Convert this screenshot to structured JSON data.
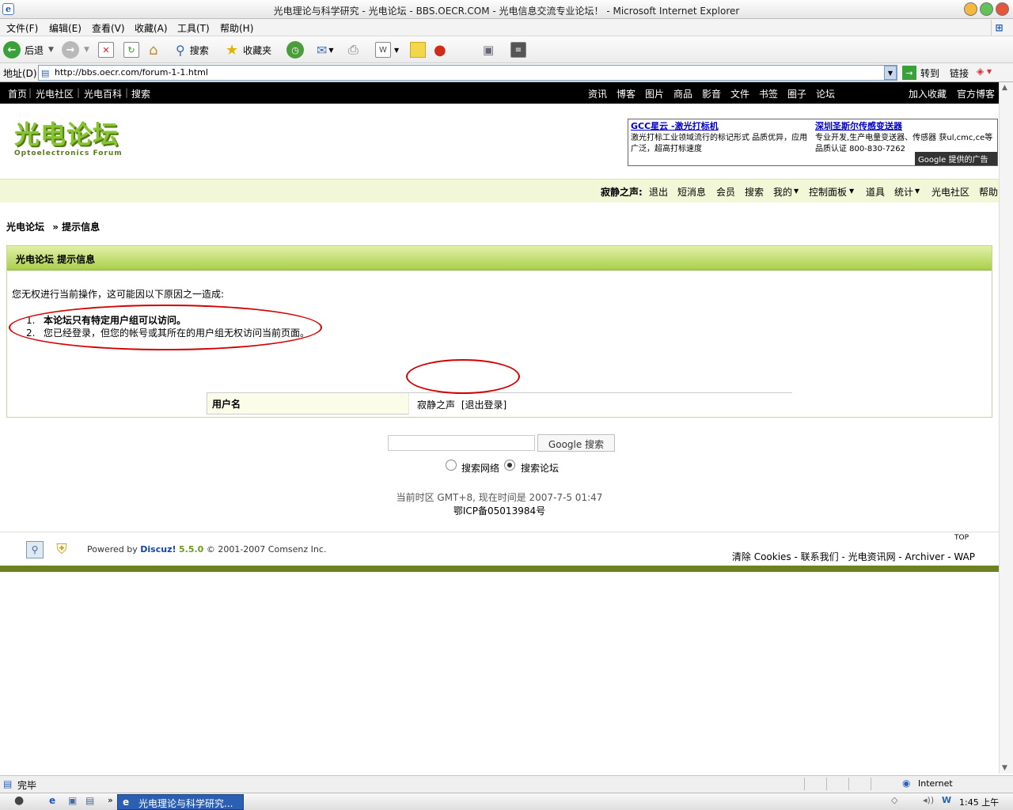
{
  "window": {
    "title": "光电理论与科学研究 - 光电论坛 - BBS.OECR.COM - 光电信息交流专业论坛！ - Microsoft Internet Explorer"
  },
  "menu": [
    "文件(F)",
    "编辑(E)",
    "查看(V)",
    "收藏(A)",
    "工具(T)",
    "帮助(H)"
  ],
  "toolbar": {
    "back": "后退",
    "search": "搜索",
    "favorites": "收藏夹"
  },
  "address": {
    "label": "地址(D)",
    "url": "http://bbs.oecr.com/forum-1-1.html",
    "go": "转到",
    "links": "链接"
  },
  "topnav": {
    "left": [
      "首页",
      "光电社区",
      "光电百科",
      "搜索"
    ],
    "right": [
      "资讯",
      "博客",
      "图片",
      "商品",
      "影音",
      "文件",
      "书签",
      "圈子",
      "论坛"
    ],
    "far": [
      "加入收藏",
      "官方博客"
    ]
  },
  "logo": {
    "title": "光电论坛",
    "subtitle": "Optoelectronics Forum"
  },
  "ad": {
    "left_title": "GCC星云 -激光打标机",
    "left_text": "激光打标工业领域流行的标记形式 品质优异，应用广泛，超高打标速度",
    "right_title": "深圳圣斯尔传感变送器",
    "right_text": "专业开发,生产电量变送器、传感器 获ul,cmc,ce等品质认证 800-830-7262",
    "google": "Google 提供的广告"
  },
  "userbar": {
    "username": "寂静之声:",
    "links": [
      "退出",
      "短消息",
      "会员",
      "搜索",
      "我的",
      "控制面板",
      "道具",
      "统计",
      "光电社区",
      "帮助"
    ]
  },
  "breadcrumb": {
    "home": "光电论坛",
    "current": "» 提示信息"
  },
  "message": {
    "header": "光电论坛  提示信息",
    "intro": "您无权进行当前操作，这可能因以下原因之一造成:",
    "reasons": [
      {
        "num": "1.",
        "text": "本论坛只有特定用户组可以访问。"
      },
      {
        "num": "2.",
        "text": "您已经登录，但您的帐号或其所在的用户组无权访问当前页面。"
      }
    ],
    "user_label": "用户名",
    "user_value": "寂静之声",
    "logout": "[退出登录]"
  },
  "google_search": {
    "button": "Google 搜索",
    "opt_web": "搜索网络",
    "opt_forum": "搜索论坛"
  },
  "footer": {
    "timezone": "当前时区  GMT+8, 现在时间是  2007-7-5 01:47",
    "icp": "鄂ICP备05013984号",
    "powered": "Powered by",
    "discuz": "Discuz!",
    "version": "5.5.0",
    "copyright": "© 2001-2007 Comsenz Inc.",
    "top": "TOP",
    "links": "清除  Cookies - 联系我们  - 光电资讯网  - Archiver - WAP"
  },
  "status": {
    "done": "完毕",
    "zone": "Internet"
  },
  "taskbar": {
    "item": "光电理论与科学研究...",
    "time": "1:45 上午"
  }
}
